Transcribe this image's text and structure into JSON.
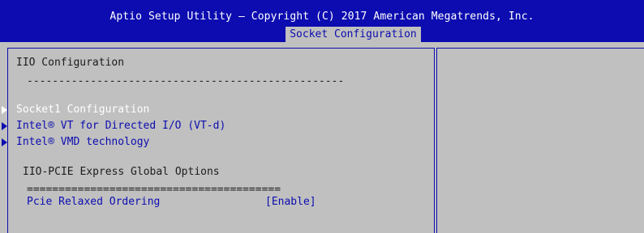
{
  "header": {
    "title": "Aptio Setup Utility – Copyright (C) 2017 American Megatrends, Inc.",
    "tab": "Socket Configuration"
  },
  "main": {
    "section_title": "IIO Configuration",
    "divider": "--------------------------------------------------",
    "menu_items": [
      {
        "label": "Socket1 Configuration",
        "selected": true
      },
      {
        "label": "Intel® VT for Directed I/O (VT-d)",
        "selected": false
      },
      {
        "label": "Intel® VMD technology",
        "selected": false
      }
    ],
    "global_options_title": "IIO-PCIE Express Global Options",
    "global_options_divider": "========================================",
    "setting": {
      "label": "Pcie Relaxed Ordering",
      "value": "[Enable]"
    }
  },
  "colors": {
    "header_bg": "#0c0cb0",
    "panel_bg": "#c0c0c0",
    "selected_text": "#ffffff",
    "menu_text": "#0c0cb0",
    "static_text": "#1c1c1c"
  }
}
